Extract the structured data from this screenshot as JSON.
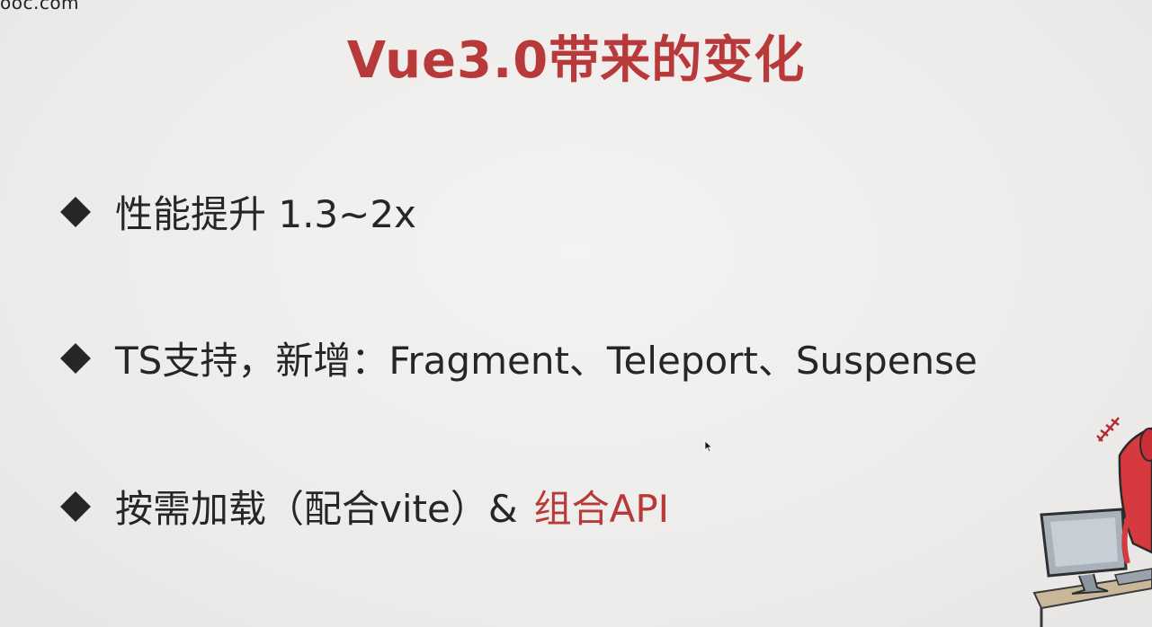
{
  "watermark": "ooc.com",
  "title": "Vue3.0带来的变化",
  "bullets": [
    {
      "text": "性能提升 1.3~2x"
    },
    {
      "text": "TS支持，新增：Fragment、Teleport、Suspense"
    },
    {
      "text": "按需加载（配合vite）&",
      "highlight": "组合API"
    }
  ],
  "colors": {
    "title": "#b8393a",
    "text": "#262626",
    "highlight": "#b8393a",
    "background": "#efeeec"
  },
  "icons": {
    "bullet": "diamond-bullet-icon",
    "cursor": "mouse-cursor-icon",
    "illustration": "character-at-computer-illustration"
  }
}
